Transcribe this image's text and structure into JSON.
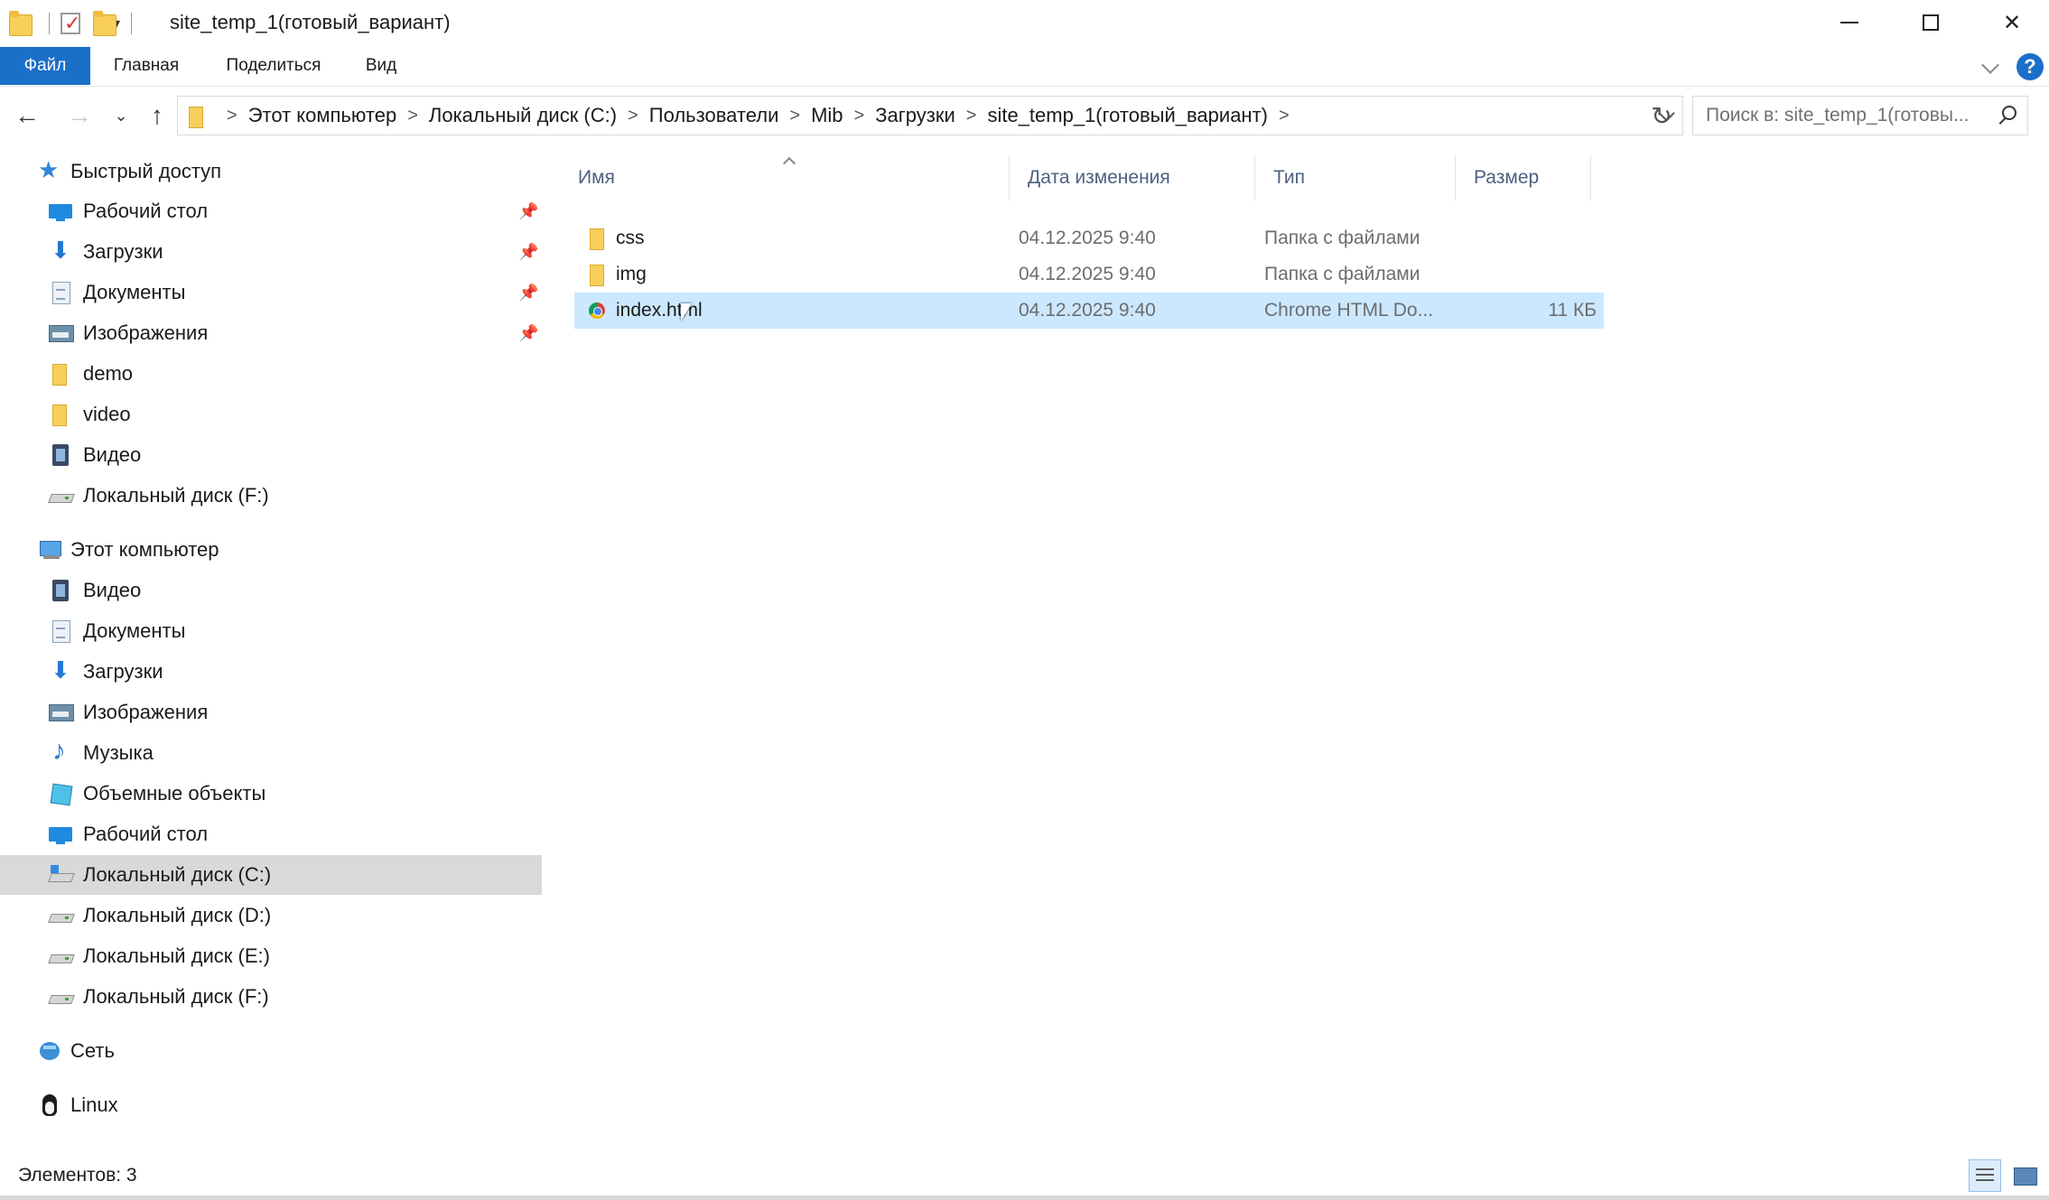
{
  "window": {
    "title": "site_temp_1(готовый_вариант)",
    "close_glyph": "✕"
  },
  "ribbon": {
    "tabs": [
      "Файл",
      "Главная",
      "Поделиться",
      "Вид"
    ],
    "help_glyph": "?",
    "accent_color": "#1a6fc9"
  },
  "nav": {
    "back_glyph": "←",
    "forward_glyph": "→",
    "recent_glyph": "⌄",
    "up_glyph": "↑",
    "refresh_glyph": "↻"
  },
  "address": {
    "breadcrumbs": [
      "Этот компьютер",
      "Локальный диск (C:)",
      "Пользователи",
      "Mib",
      "Загрузки",
      "site_temp_1(готовый_вариант)"
    ],
    "separator": ">"
  },
  "search": {
    "placeholder": "Поиск в: site_temp_1(готовы..."
  },
  "sidebar": {
    "pin_glyph": "📌",
    "quick_access": {
      "label": "Быстрый доступ",
      "icon": "star-icon",
      "items": [
        {
          "label": "Рабочий стол",
          "icon": "desktop-icon",
          "pinned": true
        },
        {
          "label": "Загрузки",
          "icon": "downloads-icon",
          "pinned": true
        },
        {
          "label": "Документы",
          "icon": "documents-icon",
          "pinned": true
        },
        {
          "label": "Изображения",
          "icon": "pictures-icon",
          "pinned": true
        },
        {
          "label": "demo",
          "icon": "folder-icon",
          "pinned": false
        },
        {
          "label": "video",
          "icon": "folder-icon",
          "pinned": false
        },
        {
          "label": "Видео",
          "icon": "video-icon",
          "pinned": false
        },
        {
          "label": "Локальный диск (F:)",
          "icon": "drive-icon",
          "pinned": false
        }
      ]
    },
    "this_pc": {
      "label": "Этот компьютер",
      "icon": "computer-icon",
      "items": [
        {
          "label": "Видео",
          "icon": "video-icon"
        },
        {
          "label": "Документы",
          "icon": "documents-icon"
        },
        {
          "label": "Загрузки",
          "icon": "downloads-icon"
        },
        {
          "label": "Изображения",
          "icon": "pictures-icon"
        },
        {
          "label": "Музыка",
          "icon": "music-icon"
        },
        {
          "label": "Объемные объекты",
          "icon": "3d-objects-icon"
        },
        {
          "label": "Рабочий стол",
          "icon": "desktop-icon"
        },
        {
          "label": "Локальный диск (C:)",
          "icon": "system-drive-icon",
          "selected": true
        },
        {
          "label": "Локальный диск (D:)",
          "icon": "drive-icon"
        },
        {
          "label": "Локальный диск (E:)",
          "icon": "drive-icon"
        },
        {
          "label": "Локальный диск (F:)",
          "icon": "drive-icon"
        }
      ]
    },
    "network": {
      "label": "Сеть",
      "icon": "network-icon"
    },
    "linux": {
      "label": "Linux",
      "icon": "linux-icon"
    }
  },
  "files": {
    "columns": [
      "Имя",
      "Дата изменения",
      "Тип",
      "Размер"
    ],
    "rows": [
      {
        "name": "css",
        "date": "04.12.2025 9:40",
        "type": "Папка с файлами",
        "size": "",
        "icon": "folder-icon"
      },
      {
        "name": "img",
        "date": "04.12.2025 9:40",
        "type": "Папка с файлами",
        "size": "",
        "icon": "folder-icon"
      },
      {
        "name": "index.html",
        "date": "04.12.2025 9:40",
        "type": "Chrome HTML Do...",
        "size": "11 КБ",
        "icon": "chrome-icon",
        "selected": true
      }
    ]
  },
  "status": {
    "text": "Элементов: 3"
  }
}
